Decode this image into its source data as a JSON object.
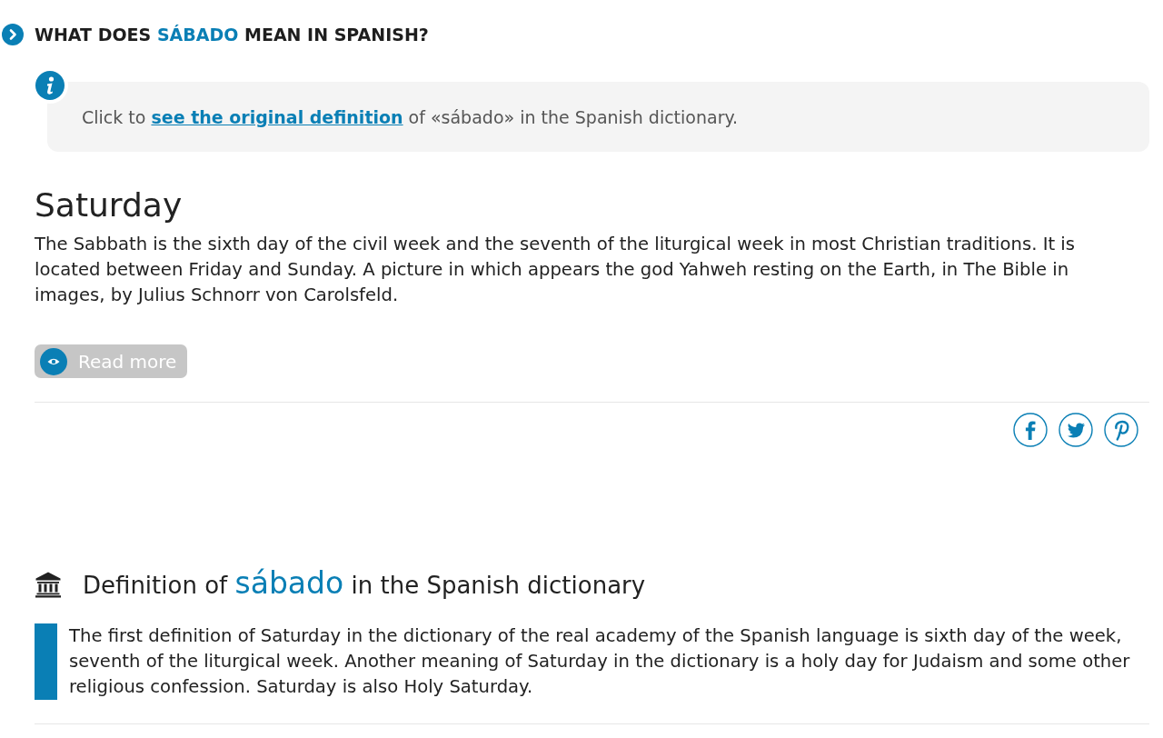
{
  "section_heading": {
    "before": "WHAT DOES",
    "highlight": "SÁBADO",
    "after": "MEAN IN SPANISH?"
  },
  "info_note": {
    "before": "Click to",
    "link": "see the original definition",
    "after": "of «sábado» in the Spanish dictionary."
  },
  "entry": {
    "title": "Saturday",
    "text": "The Sabbath is the sixth day of the civil week and the seventh of the liturgical week in most Christian traditions. It is located between Friday and Sunday. A picture in which appears the god Yahweh resting on the Earth, in The Bible in images, by Julius Schnorr von Carolsfeld.",
    "button": "Read more"
  },
  "dictionary": {
    "heading": {
      "before": "Definition of",
      "highlight": "sábado",
      "after": "in the Spanish dictionary"
    },
    "text": "The first definition of Saturday in the dictionary of the real academy of the Spanish language is sixth day of the week, seventh of the liturgical week. Another meaning of Saturday in the dictionary is a holy day for Judaism and some other religious confession. Saturday is also Holy Saturday."
  }
}
